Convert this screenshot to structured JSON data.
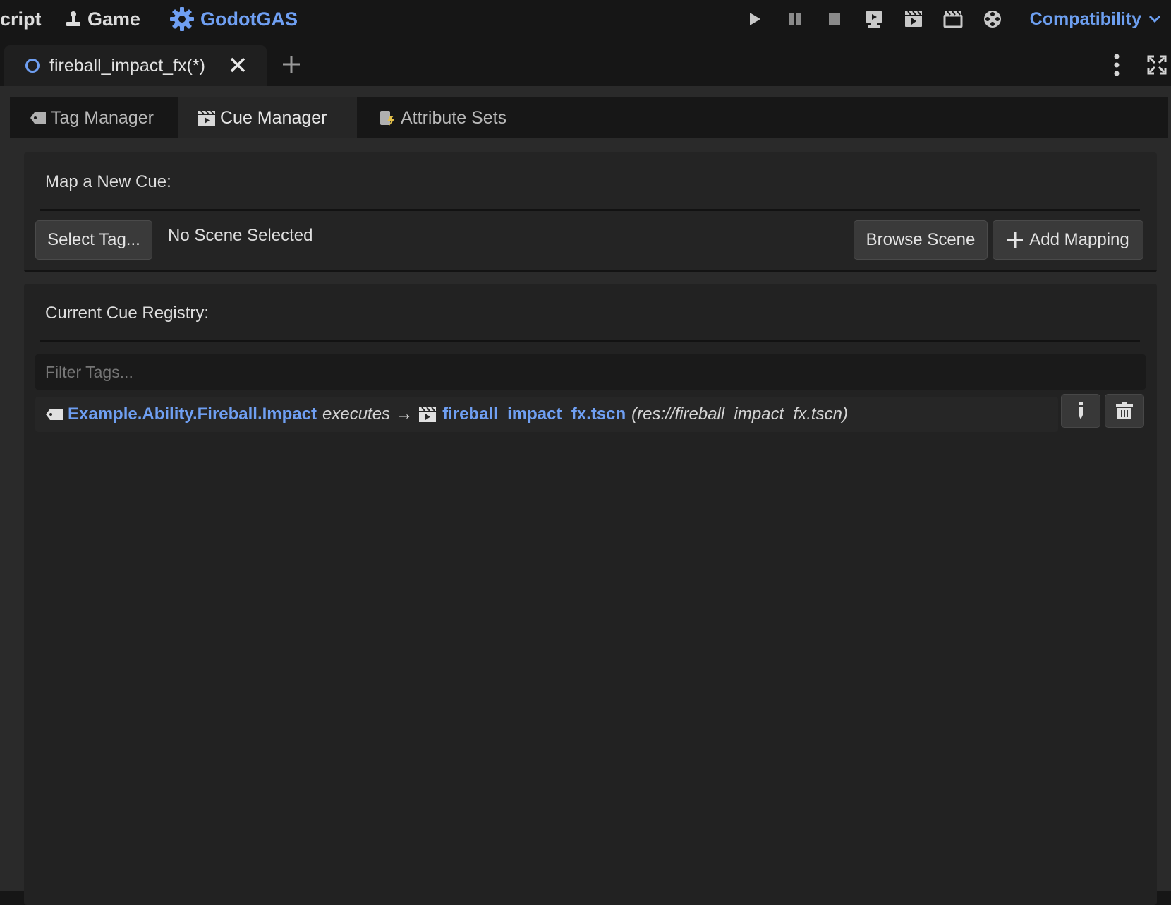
{
  "top_menu": {
    "items": [
      {
        "label": "cript",
        "icon": ""
      },
      {
        "label": "Game",
        "icon": "joystick-icon"
      },
      {
        "label": "GodotGAS",
        "icon": "gear-icon",
        "active": true
      }
    ],
    "run_controls": [
      "play-icon",
      "pause-icon",
      "stop-icon",
      "remote-debug-icon",
      "run-scene-icon",
      "run-custom-scene-icon",
      "movie-maker-icon"
    ],
    "renderer": "Compatibility"
  },
  "scene_tabs": {
    "active_tab": "fireball_impact_fx(*)"
  },
  "plugin_tabs": [
    {
      "label": "Tag Manager",
      "icon": "tag-icon",
      "active": false
    },
    {
      "label": "Cue Manager",
      "icon": "clapperboard-icon",
      "active": true
    },
    {
      "label": "Attribute Sets",
      "icon": "attribute-icon",
      "active": false
    }
  ],
  "new_cue": {
    "heading": "Map a New Cue:",
    "select_tag": "Select Tag...",
    "scene_status": "No Scene Selected",
    "browse": "Browse Scene",
    "add": "Add Mapping"
  },
  "registry": {
    "heading": "Current Cue Registry:",
    "filter_placeholder": "Filter Tags...",
    "entries": [
      {
        "tag": "Example.Ability.Fireball.Impact",
        "verb": "executes",
        "arrow": "→",
        "scene": "fireball_impact_fx.tscn",
        "path": "(res://fireball_impact_fx.tscn)"
      }
    ]
  },
  "colors": {
    "accent": "#6f9ff2",
    "background": "#161616",
    "panel": "#242424"
  }
}
